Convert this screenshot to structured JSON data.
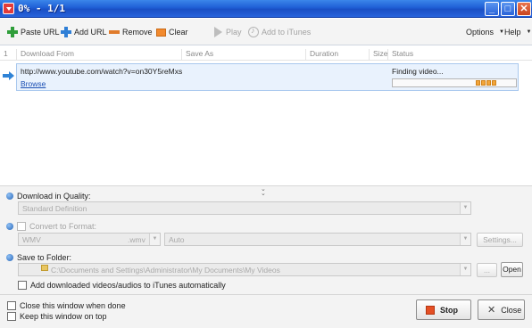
{
  "window": {
    "title": "0% - 1/1",
    "controls": {
      "minimize": "_",
      "maximize": "□",
      "close": "✕"
    }
  },
  "toolbar": {
    "paste_url": "Paste URL",
    "add_url": "Add URL",
    "remove": "Remove",
    "clear": "Clear",
    "play": "Play",
    "add_to_itunes": "Add to iTunes",
    "options": "Options",
    "help": "Help"
  },
  "list": {
    "columns": [
      "1",
      "Download From",
      "Save As",
      "Duration",
      "Size",
      "Status"
    ],
    "rows": [
      {
        "url": "http://www.youtube.com/watch?v=on30Y5reMxs",
        "browse": "Browse",
        "status": "Finding video...",
        "progress": 0.72
      }
    ]
  },
  "options": {
    "quality_label": "Download in Quality:",
    "quality_value": "Standard Definition",
    "convert_label": "Convert to Format:",
    "format_value": "WMV",
    "format_ext": ".wmv",
    "auto_value": "Auto",
    "settings_button": "Settings...",
    "save_label": "Save to Folder:",
    "folder_value": "C:\\Documents and Settings\\Administrator\\My Documents\\My Videos",
    "browse_button": "...",
    "open_button": "Open",
    "itunes_label": "Add downloaded videos/audios to iTunes automatically"
  },
  "bottom": {
    "close_when_done": "Close this window when done",
    "keep_on_top": "Keep this window on top",
    "stop": "Stop",
    "close": "Close"
  },
  "colors": {
    "title_bar": "#1f5fd6",
    "selection": "#e9f2fd",
    "progress": "#f2a53a",
    "stop_icon": "#e44f24"
  }
}
